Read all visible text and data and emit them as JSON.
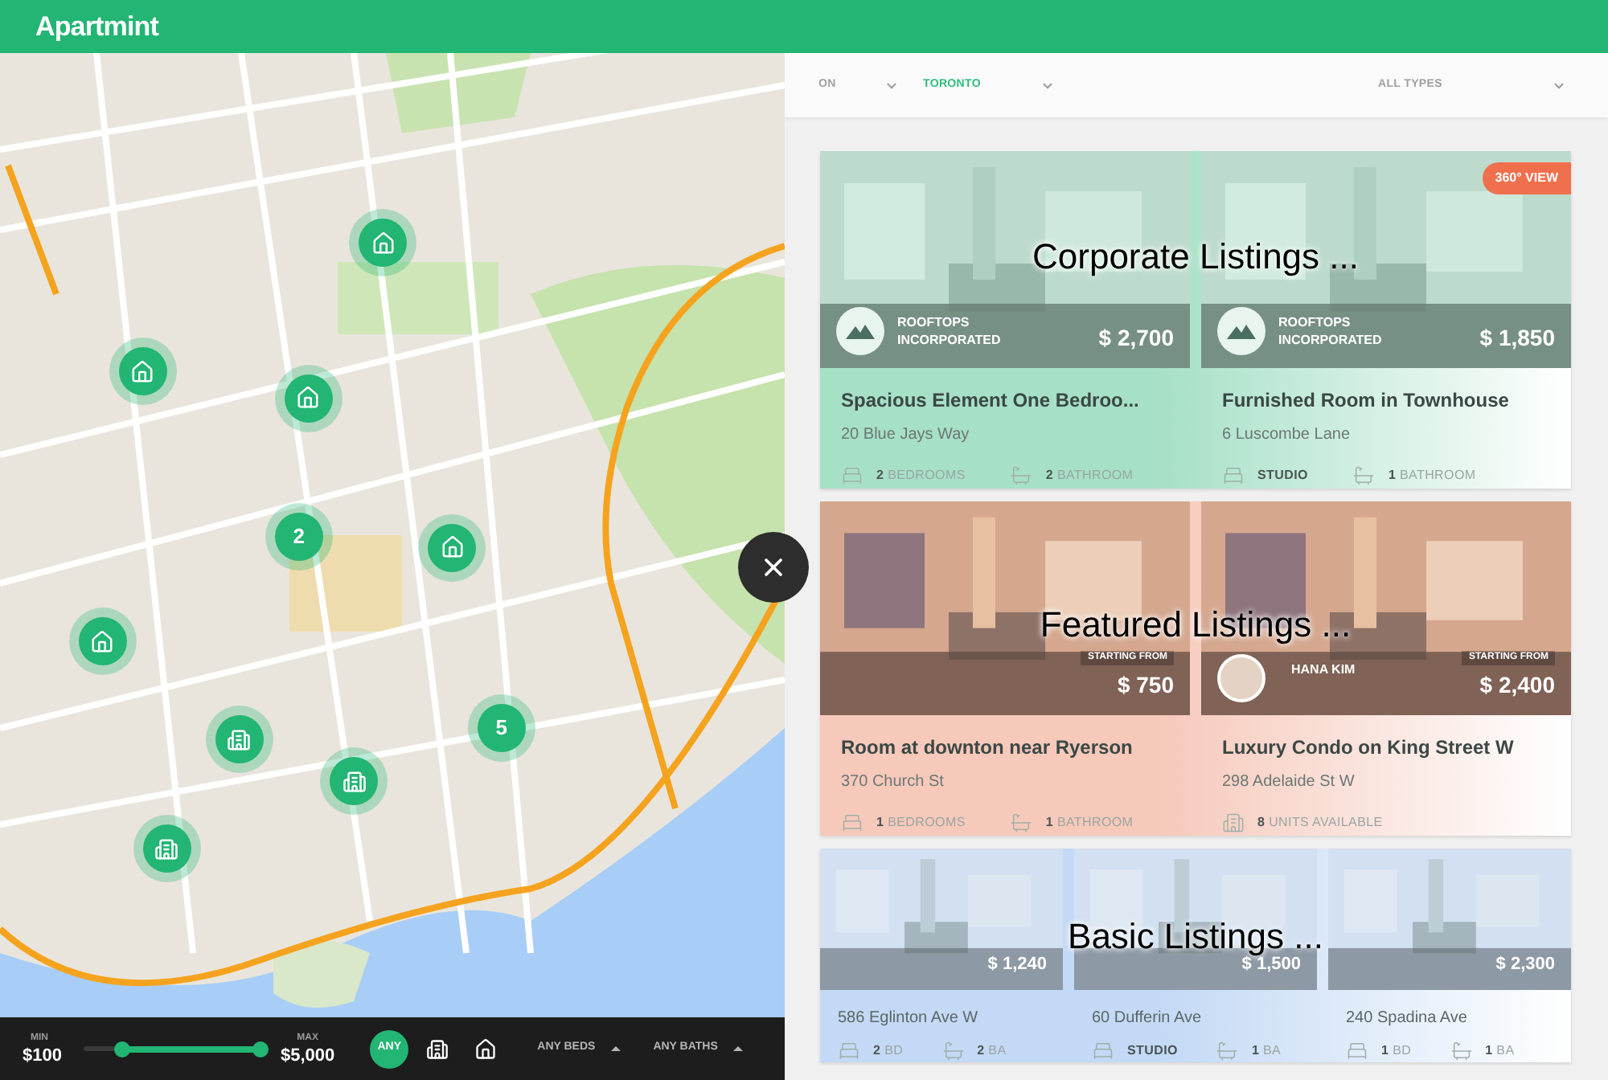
{
  "header": {
    "logo": "Apartmint"
  },
  "filters": [
    {
      "label": "ON",
      "active": false
    },
    {
      "label": "TORONTO",
      "active": true
    },
    {
      "label": "ALL TYPES",
      "active": false
    }
  ],
  "map": {
    "markers": [
      {
        "kind": "house"
      },
      {
        "kind": "house"
      },
      {
        "kind": "house"
      },
      {
        "kind": "cluster",
        "count": "2"
      },
      {
        "kind": "house"
      },
      {
        "kind": "house"
      },
      {
        "kind": "cluster",
        "count": "5"
      },
      {
        "kind": "building"
      },
      {
        "kind": "building"
      },
      {
        "kind": "building"
      }
    ]
  },
  "price_filter": {
    "min_label": "MIN",
    "min": "$100",
    "max_label": "MAX",
    "max": "$5,000"
  },
  "type_buttons": [
    {
      "kind": "any",
      "label": "ANY",
      "selected": true
    },
    {
      "kind": "building",
      "selected": false
    },
    {
      "kind": "house",
      "selected": false
    }
  ],
  "dropdowns": [
    "ANY BEDS",
    "ANY BATHS"
  ],
  "sections": [
    {
      "kind": "corporate",
      "title": "Corporate Listings ...",
      "color": "#a6e0c6",
      "listings": [
        {
          "title": "Spacious Element One Bedroo...",
          "address": "20 Blue Jays Way",
          "price": "$ 2,700",
          "company": "ROOFTOPS INCORPORATED",
          "features": [
            {
              "kind": "bed",
              "count": "2",
              "unit": "BEDROOMS"
            },
            {
              "kind": "bath",
              "count": "2",
              "unit": "BATHROOM"
            }
          ]
        },
        {
          "title": "Furnished Room in Townhouse",
          "address": "6 Luscombe Lane",
          "price": "$ 1,850",
          "company": "ROOFTOPS INCORPORATED",
          "badge": "360° VIEW",
          "features": [
            {
              "kind": "bed",
              "count": "STUDIO"
            },
            {
              "kind": "bath",
              "count": "1",
              "unit": "BATHROOM"
            }
          ]
        }
      ]
    },
    {
      "kind": "featured",
      "title": "Featured Listings ...",
      "color": "#f6c9bb",
      "listings": [
        {
          "title": "Room at downton near Ryerson",
          "address": "370 Church St",
          "price_caption": "STARTING FROM",
          "price": "$ 750",
          "features": [
            {
              "kind": "bed",
              "count": "1",
              "unit": "BEDROOMS"
            },
            {
              "kind": "bath",
              "count": "1",
              "unit": "BATHROOM"
            }
          ]
        },
        {
          "title": "Luxury Condo on King Street W",
          "address": "298 Adelaide St W",
          "price_caption": "STARTING FROM",
          "price": "$ 2,400",
          "agent": "HANA KIM",
          "features": [
            {
              "kind": "units",
              "count": "8",
              "unit": "UNITS  AVAILABLE"
            }
          ]
        }
      ]
    },
    {
      "kind": "basic",
      "title": "Basic Listings ...",
      "color": "#c3d9f5",
      "listings": [
        {
          "address": "586 Eglinton Ave W",
          "price": "$ 1,240",
          "features": [
            {
              "kind": "bed",
              "count": "2",
              "unit": "BD"
            },
            {
              "kind": "bath",
              "count": "2",
              "unit": "BA"
            }
          ]
        },
        {
          "address": "60 Dufferin Ave",
          "price": "$ 1,500",
          "features": [
            {
              "kind": "bed",
              "count": "STUDIO"
            },
            {
              "kind": "bath",
              "count": "1",
              "unit": "BA"
            }
          ]
        },
        {
          "address": "240 Spadina Ave",
          "price": "$ 2,300",
          "features": [
            {
              "kind": "bed",
              "count": "1",
              "unit": "BD"
            },
            {
              "kind": "bath",
              "count": "1",
              "unit": "BA"
            }
          ]
        }
      ]
    }
  ]
}
